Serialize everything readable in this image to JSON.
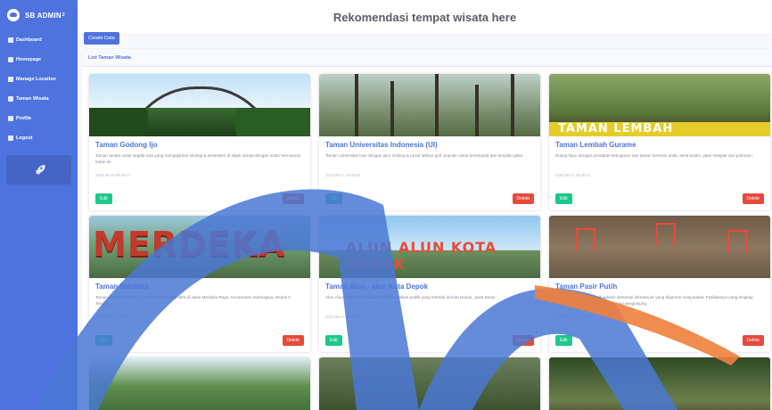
{
  "sidebar": {
    "brand": "SB ADMIN",
    "brand_sup": "2",
    "items": [
      {
        "label": "Dashboard",
        "icon": "tachometer-icon"
      },
      {
        "label": "Homepage",
        "icon": "home-icon"
      },
      {
        "label": "Manage Location",
        "icon": "map-marker-icon"
      },
      {
        "label": "Taman Wisata",
        "icon": "tree-icon"
      },
      {
        "label": "Profile",
        "icon": "user-icon"
      },
      {
        "label": "Logout",
        "icon": "sign-out-icon"
      }
    ],
    "card_icon": "rocket-icon"
  },
  "header": {
    "title": "Rekomendasi tempat wisata here"
  },
  "actions": {
    "create_label": "Create Data"
  },
  "list": {
    "title": "List Taman Wisata",
    "cards": [
      {
        "title": "Taman Godong Ijo",
        "desc": "Taman wisata untuk segala usia yang mengajarkan ekologi & ekosistem di objek wisata dengan motto bernuansa hutan ini.",
        "date": "2022-05-16 08:19:27",
        "edit": "Edit",
        "delete": "Delete"
      },
      {
        "title": "Taman Universitas Indonesia (UI)",
        "desc": "Taman universitas luas dengan jalur molang & pusat latihan golf, populer untuk bersepeda dan berjalan-jalan.",
        "date": "2022-05-17 15:40:03",
        "edit": "Edit",
        "delete": "Delete"
      },
      {
        "title": "Taman Lembah Gurame",
        "desc": "Ruang hijau dengan peralatan kebugaran dan taman bermain anak, serta kolam, jalan setapak dan pohonan.",
        "date": "2022-05-17 16:08:14",
        "edit": "Edit",
        "delete": "Delete"
      },
      {
        "title": "Taman Merdeka",
        "desc": "Taman Merdeka namanya, berada dan diapit oleh di Jalan Merdeka Raya, Kecamatan Sukmajaya, Depok II Tengah.",
        "date": "2022-05-17 16:40:47",
        "edit": "Edit",
        "delete": "Delete"
      },
      {
        "title": "Taman Alun - alun Kota Depok",
        "desc": "Alun-Alun Kota Depok adalah sebuah fasilitas publik yang terletak di Kota Depok, Jawa Barat.",
        "date": "2022-05-17 17:04:40",
        "edit": "Edit",
        "delete": "Delete"
      },
      {
        "title": "Taman Pasir Putih",
        "desc": "Taman Wisata Pasir Putih adalah destinasi rekreasi air yang digemari masyarakat. Fasilitasnya yang lengkap membuat tempat ini tidak pernah sepi pengunjung.",
        "date": "2022-05-17 17:27:00",
        "edit": "Edit",
        "delete": "Delete"
      }
    ]
  },
  "images": {
    "lembah_banner": "TAMAN LEMBAH",
    "merdeka_word": "MERDEKA",
    "alun_sign": "ALUN ALUN  KOTA DEPOK"
  },
  "colors": {
    "primary": "#4e73df",
    "success": "#1cc88a",
    "danger": "#e74a3b",
    "watermark_blue": "#4a78d4",
    "watermark_orange": "#f07f3c"
  }
}
